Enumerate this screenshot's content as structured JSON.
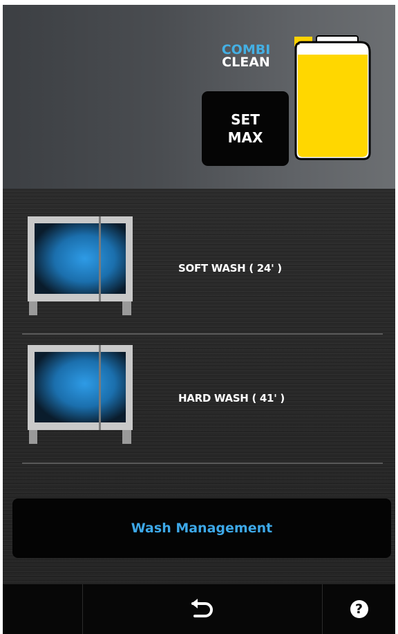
{
  "brand": {
    "line1": "COMBI",
    "line2": "CLEAN",
    "line1_color": "#44b0e4",
    "line2_color": "#ffffff"
  },
  "header": {
    "set_max_line1": "SET",
    "set_max_line2": "MAX",
    "tank_fill_color": "#ffd700",
    "tank_level": 0.95
  },
  "wash_options": [
    {
      "label": "SOFT WASH ( 24' )",
      "icon": "oven-icon"
    },
    {
      "label": "HARD WASH ( 41' )",
      "icon": "oven-icon"
    }
  ],
  "wash_management": {
    "label": "Wash Management",
    "color": "#3da8e8"
  },
  "navbar": {
    "back_icon": "back-arrow-icon",
    "help_label": "?"
  }
}
